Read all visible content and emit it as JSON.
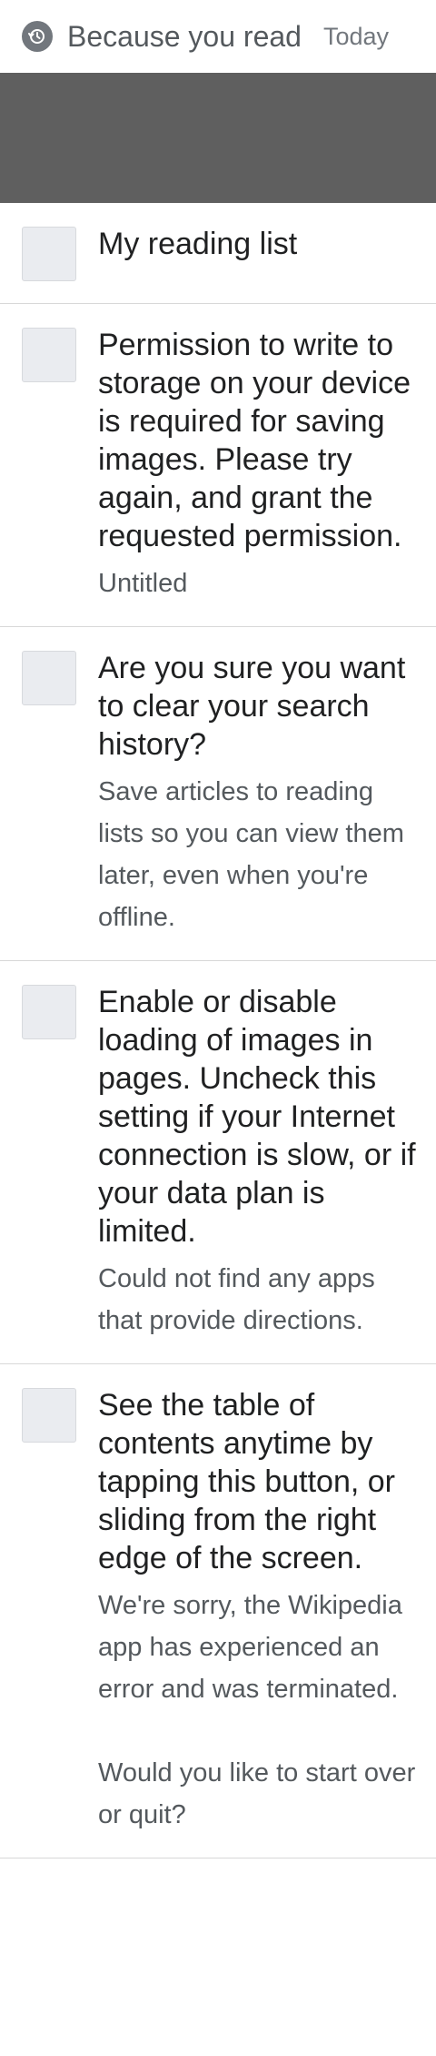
{
  "header": {
    "icon": "history-icon",
    "title": "Because you read",
    "date": "Today"
  },
  "colors": {
    "banner": "#5f5f5f",
    "thumbnail_placeholder": "#eaecf0",
    "divider": "#d8d8d8"
  },
  "items": [
    {
      "title": "My reading list",
      "description": ""
    },
    {
      "title": "Permission to write to storage on your device is required for saving images. Please try again, and grant the requested permission.",
      "description": "Untitled"
    },
    {
      "title": "Are you sure you want to clear your search history?",
      "description": "Save articles to reading lists so you can view them later, even when you're offline."
    },
    {
      "title": "Enable or disable loading of images in pages. Uncheck this setting if your Internet connection is slow, or if your data plan is limited.",
      "description": "Could not find any apps that provide directions."
    },
    {
      "title": "See the table of contents anytime by tapping this button, or sliding from the right edge of the screen.",
      "description": "We're sorry, the Wikipedia app has experienced an error and was terminated.\n\nWould you like to start over or quit?"
    }
  ]
}
